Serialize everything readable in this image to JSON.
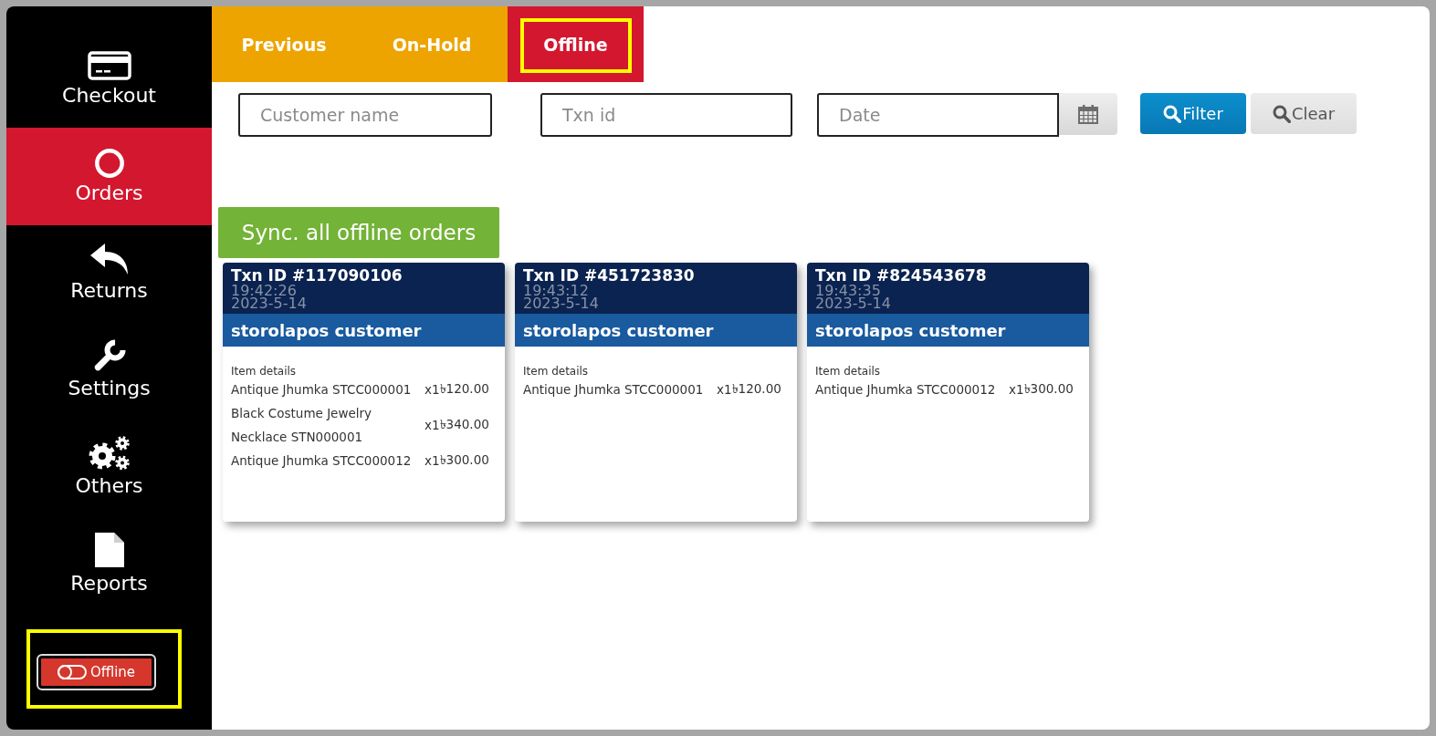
{
  "sidebar": {
    "items": [
      {
        "label": "Checkout",
        "selected": false
      },
      {
        "label": "Orders",
        "selected": true
      },
      {
        "label": "Returns",
        "selected": false
      },
      {
        "label": "Settings",
        "selected": false
      },
      {
        "label": "Others",
        "selected": false
      },
      {
        "label": "Reports",
        "selected": false
      }
    ],
    "connection_toggle": {
      "label": "Offline",
      "online": false,
      "highlighted": true
    }
  },
  "tabs": [
    {
      "label": "Previous",
      "selected": false,
      "highlighted": false
    },
    {
      "label": "On-Hold",
      "selected": false,
      "highlighted": false
    },
    {
      "label": "Offline",
      "selected": true,
      "highlighted": true
    }
  ],
  "filters": {
    "customer_field": {
      "placeholder": "Customer name"
    },
    "txn_field": {
      "placeholder": "Txn id"
    },
    "date_field": {
      "placeholder": "Date"
    },
    "buttons": [
      {
        "label": "Filter",
        "kind": "primary"
      },
      {
        "label": "Clear",
        "kind": "secondary"
      }
    ]
  },
  "sync_button": {
    "label": "Sync. all offline orders"
  },
  "orders": [
    {
      "txn_id": "Txn ID #117090106",
      "time": "19:42:26",
      "date": "2023-5-14",
      "customer": "storolapos customer",
      "items_heading": "Item details",
      "items": [
        {
          "name": "Antique Jhumka STCC000001",
          "qty": "x1",
          "price": "৳120.00"
        },
        {
          "name": "Black Costume Jewelry Necklace STN000001",
          "qty": "x1",
          "price": "৳340.00"
        },
        {
          "name": "Antique Jhumka STCC000012",
          "qty": "x1",
          "price": "৳300.00"
        }
      ]
    },
    {
      "txn_id": "Txn ID #451723830",
      "time": "19:43:12",
      "date": "2023-5-14",
      "customer": "storolapos customer",
      "items_heading": "Item details",
      "items": [
        {
          "name": "Antique Jhumka STCC000001",
          "qty": "x1",
          "price": "৳120.00"
        }
      ]
    },
    {
      "txn_id": "Txn ID #824543678",
      "time": "19:43:35",
      "date": "2023-5-14",
      "customer": "storolapos customer",
      "items_heading": "Item details",
      "items": [
        {
          "name": "Antique Jhumka STCC000012",
          "qty": "x1",
          "price": "৳300.00"
        }
      ]
    }
  ]
}
